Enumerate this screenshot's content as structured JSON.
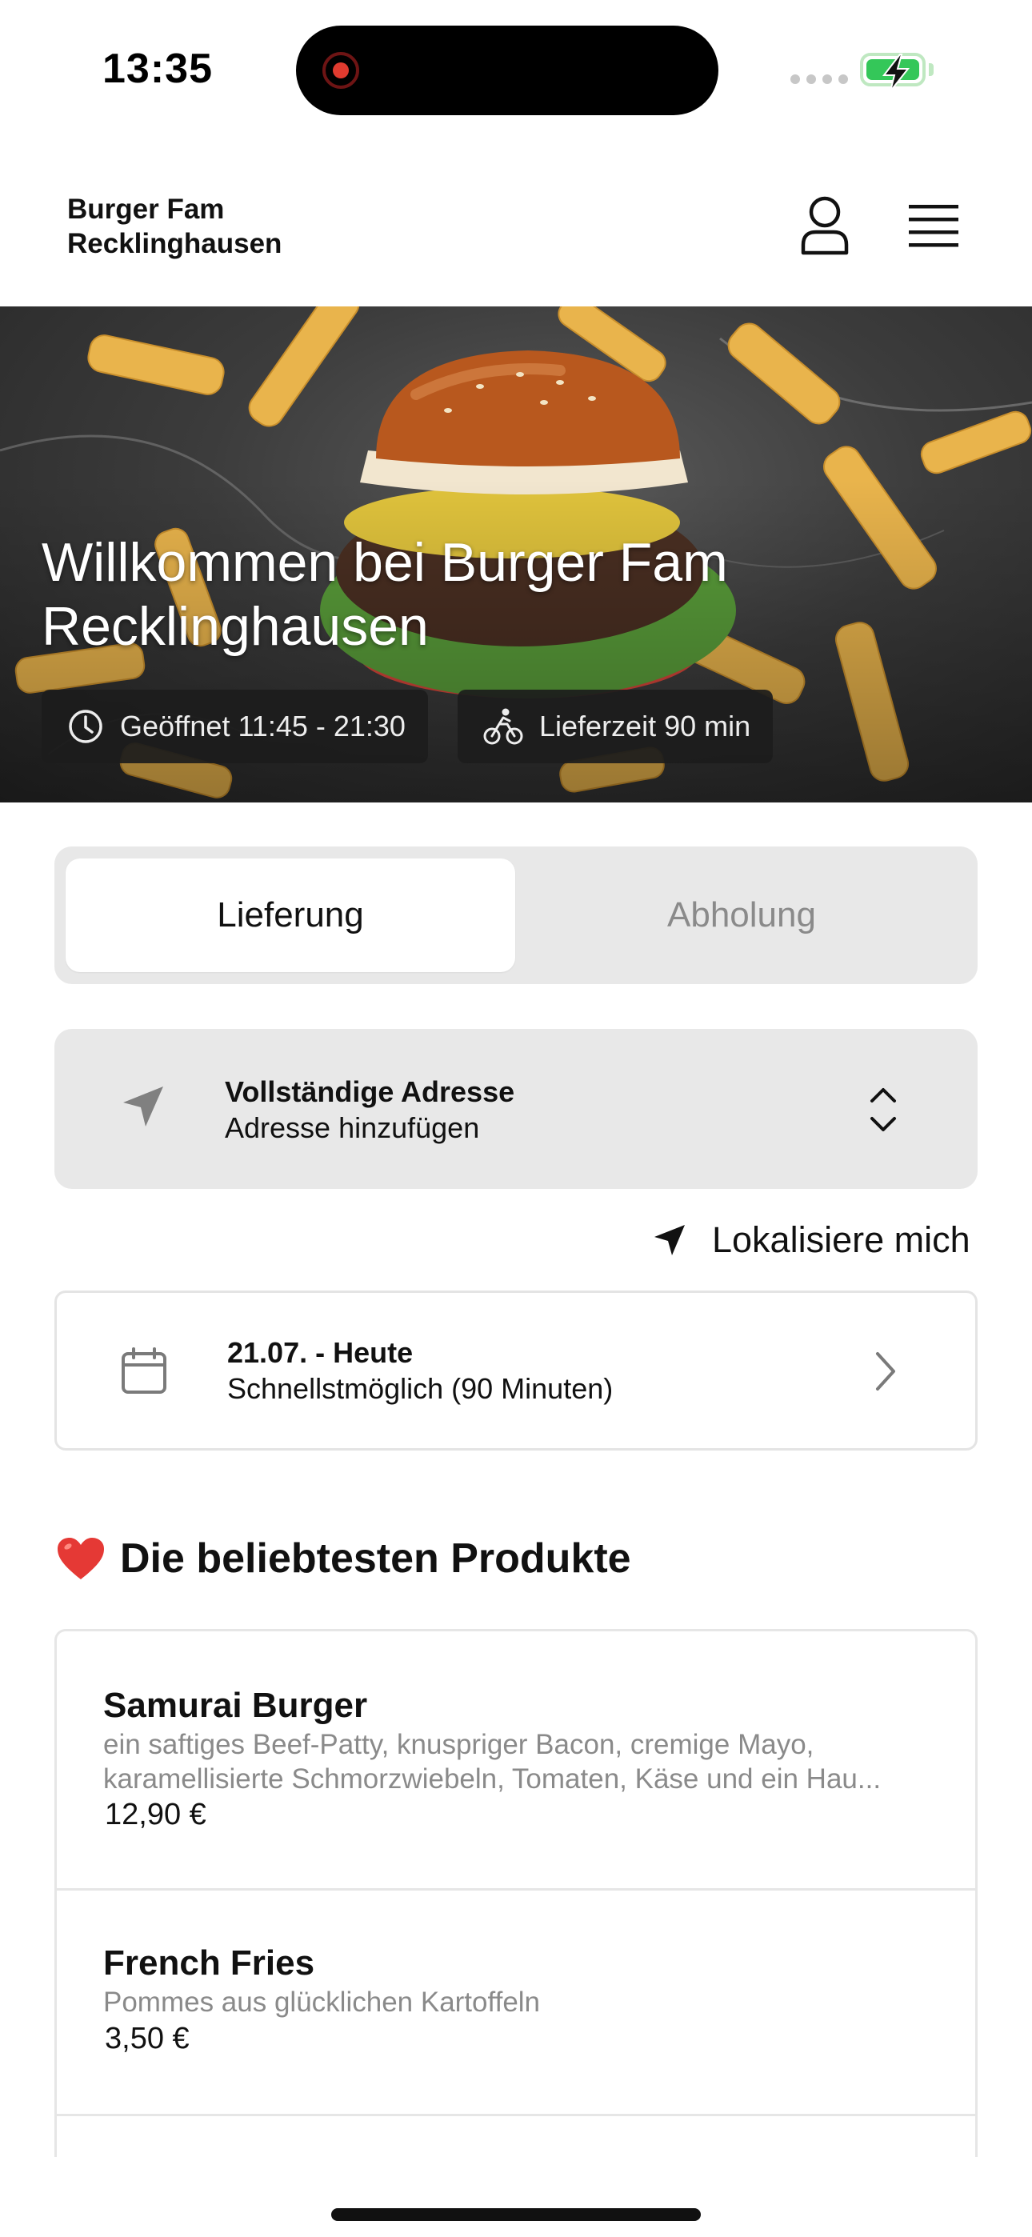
{
  "status_bar": {
    "time": "13:35"
  },
  "header": {
    "restaurant_name": "Burger Fam Recklinghausen",
    "user_icon": "user-icon",
    "menu_icon": "hamburger-menu-icon"
  },
  "hero": {
    "title": "Willkommen bei Burger Fam Recklinghausen",
    "hours_label": "Geöffnet 11:45 - 21:30",
    "delivery_time_label": "Lieferzeit 90 min"
  },
  "order_mode": {
    "options": [
      "Lieferung",
      "Abholung"
    ],
    "selected": "Lieferung"
  },
  "address": {
    "title": "Vollständige Adresse",
    "subtitle": "Adresse hinzufügen",
    "locate_label": "Lokalisiere mich"
  },
  "schedule": {
    "date": "21.07. - Heute",
    "time": "Schnellstmöglich (90 Minuten)"
  },
  "popular": {
    "emoji": "❤️",
    "title": "Die beliebtesten Produkte",
    "products": [
      {
        "name": "Samurai Burger",
        "description": "ein saftiges Beef-Patty, knuspriger Bacon, cremige Mayo, karamellisierte Schmorzwiebeln, Tomaten, Käse und ein Hau...",
        "price": "12,90 €"
      },
      {
        "name": "French Fries",
        "description": "Pommes aus glücklichen Kartoffeln",
        "price": "3,50 €"
      }
    ]
  },
  "colors": {
    "accent_text": "#111111",
    "muted_text": "#8a8a8a",
    "panel_bg": "#e8e8e8",
    "battery_green": "#34c759",
    "heart_red": "#e53935"
  }
}
